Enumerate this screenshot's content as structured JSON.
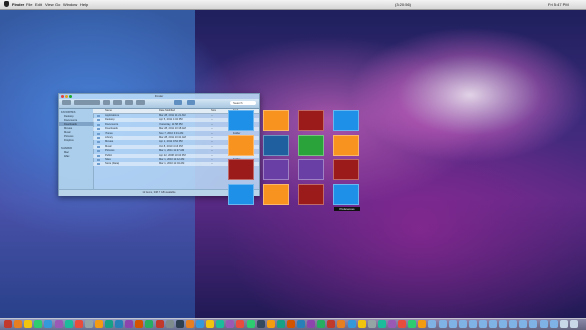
{
  "menubar": {
    "app": "Finder",
    "menus": [
      "File",
      "Edit",
      "View",
      "Go",
      "Window",
      "Help"
    ],
    "clock": "Fri 5:47 PM",
    "status_time": "(3:20:56)"
  },
  "finder": {
    "title": "Finder",
    "toolbar_labels": [
      "Back",
      "View",
      "Quick Look",
      "Action",
      "Share",
      "Arrange",
      "Path",
      "Applications",
      "Documents"
    ],
    "search_placeholder": "Search",
    "sidebar": {
      "favorites_header": "FAVORITES",
      "favorites": [
        "Desktop",
        "Documents",
        "Downloads",
        "Movies",
        "Music",
        "Pictures",
        "Dropbox"
      ],
      "shared_header": "SHARED",
      "shared": [
        "Mac",
        "iMac"
      ]
    },
    "columns": [
      "Name",
      "Date Modified",
      "Size",
      "Kind"
    ],
    "rows": [
      {
        "name": "Applications",
        "date": "Mar 28, 2011 11:21 AM",
        "size": "--",
        "kind": "Folder"
      },
      {
        "name": "Desktop",
        "date": "Apr 5, 2011 1:04 PM",
        "size": "--",
        "kind": "Folder"
      },
      {
        "name": "Documents",
        "date": "Yesterday, 11:58 PM",
        "size": "--",
        "kind": "Folder"
      },
      {
        "name": "Downloads",
        "date": "Mar 28, 2011 10:18 AM",
        "size": "--",
        "kind": "Folder"
      },
      {
        "name": "iTunes",
        "date": "Nov 7, 2010 3:31 AM",
        "size": "--",
        "kind": "Folder"
      },
      {
        "name": "Library",
        "date": "Mar 28, 2011 10:41 AM",
        "size": "--",
        "kind": "Folder"
      },
      {
        "name": "Movies",
        "date": "Apr 1, 2011 9:54 PM",
        "size": "--",
        "kind": "Folder"
      },
      {
        "name": "Music",
        "date": "Oct 8, 2010 4:16 PM",
        "size": "--",
        "kind": "Folder"
      },
      {
        "name": "Pictures",
        "date": "Mar 1, 2011 11:27 AM",
        "size": "--",
        "kind": "Folder"
      },
      {
        "name": "Public",
        "date": "Apr 22, 2008 10:34 PM",
        "size": "--",
        "kind": "Folder"
      },
      {
        "name": "Sites",
        "date": "Mar 1, 2010 11:12 AM",
        "size": "--",
        "kind": "Folder"
      },
      {
        "name": "Store (Data)",
        "date": "Mar 1, 2010 11:04 AM",
        "size": "--",
        "kind": "Folder"
      }
    ],
    "status": "12 items, 338.7 GB available"
  },
  "grid": {
    "tooltip": "Preferences",
    "colors": [
      "#1e90e8",
      "#f7931e",
      "#9b1b1b",
      "#1e90e8",
      "#f7931e",
      "#1f5fa0",
      "#2aa33a",
      "#f7931e",
      "#9b1b1b",
      "#6a3fa5",
      "#6a3fa5",
      "#9b1b1b",
      "#1e90e8",
      "#f7931e",
      "#9b1b1b",
      "#1e90e8"
    ]
  },
  "dock": {
    "icon_colors": [
      "#c0392b",
      "#e67e22",
      "#f1c40f",
      "#2ecc71",
      "#3498db",
      "#9b59b6",
      "#1abc9c",
      "#e74c3c",
      "#95a5a6",
      "#f39c12",
      "#16a085",
      "#2980b9",
      "#8e44ad",
      "#d35400",
      "#27ae60",
      "#c0392b",
      "#7f8c8d",
      "#2c3e50",
      "#e67e22",
      "#3498db",
      "#f1c40f",
      "#1abc9c",
      "#9b59b6",
      "#e74c3c",
      "#2ecc71",
      "#34495e",
      "#f39c12",
      "#16a085",
      "#d35400",
      "#2980b9",
      "#8e44ad",
      "#27ae60",
      "#c0392b",
      "#e67e22",
      "#3498db",
      "#f1c40f",
      "#95a5a6",
      "#1abc9c",
      "#9b59b6",
      "#e74c3c",
      "#2ecc71",
      "#f39c12",
      "#7fb2e5",
      "#7fb2e5",
      "#7fb2e5",
      "#7fb2e5",
      "#7fb2e5",
      "#7fb2e5",
      "#7fb2e5",
      "#7fb2e5",
      "#7fb2e5",
      "#7fb2e5",
      "#7fb2e5",
      "#7fb2e5",
      "#7fb2e5",
      "#c8d8e8",
      "#c8d8e8"
    ]
  }
}
